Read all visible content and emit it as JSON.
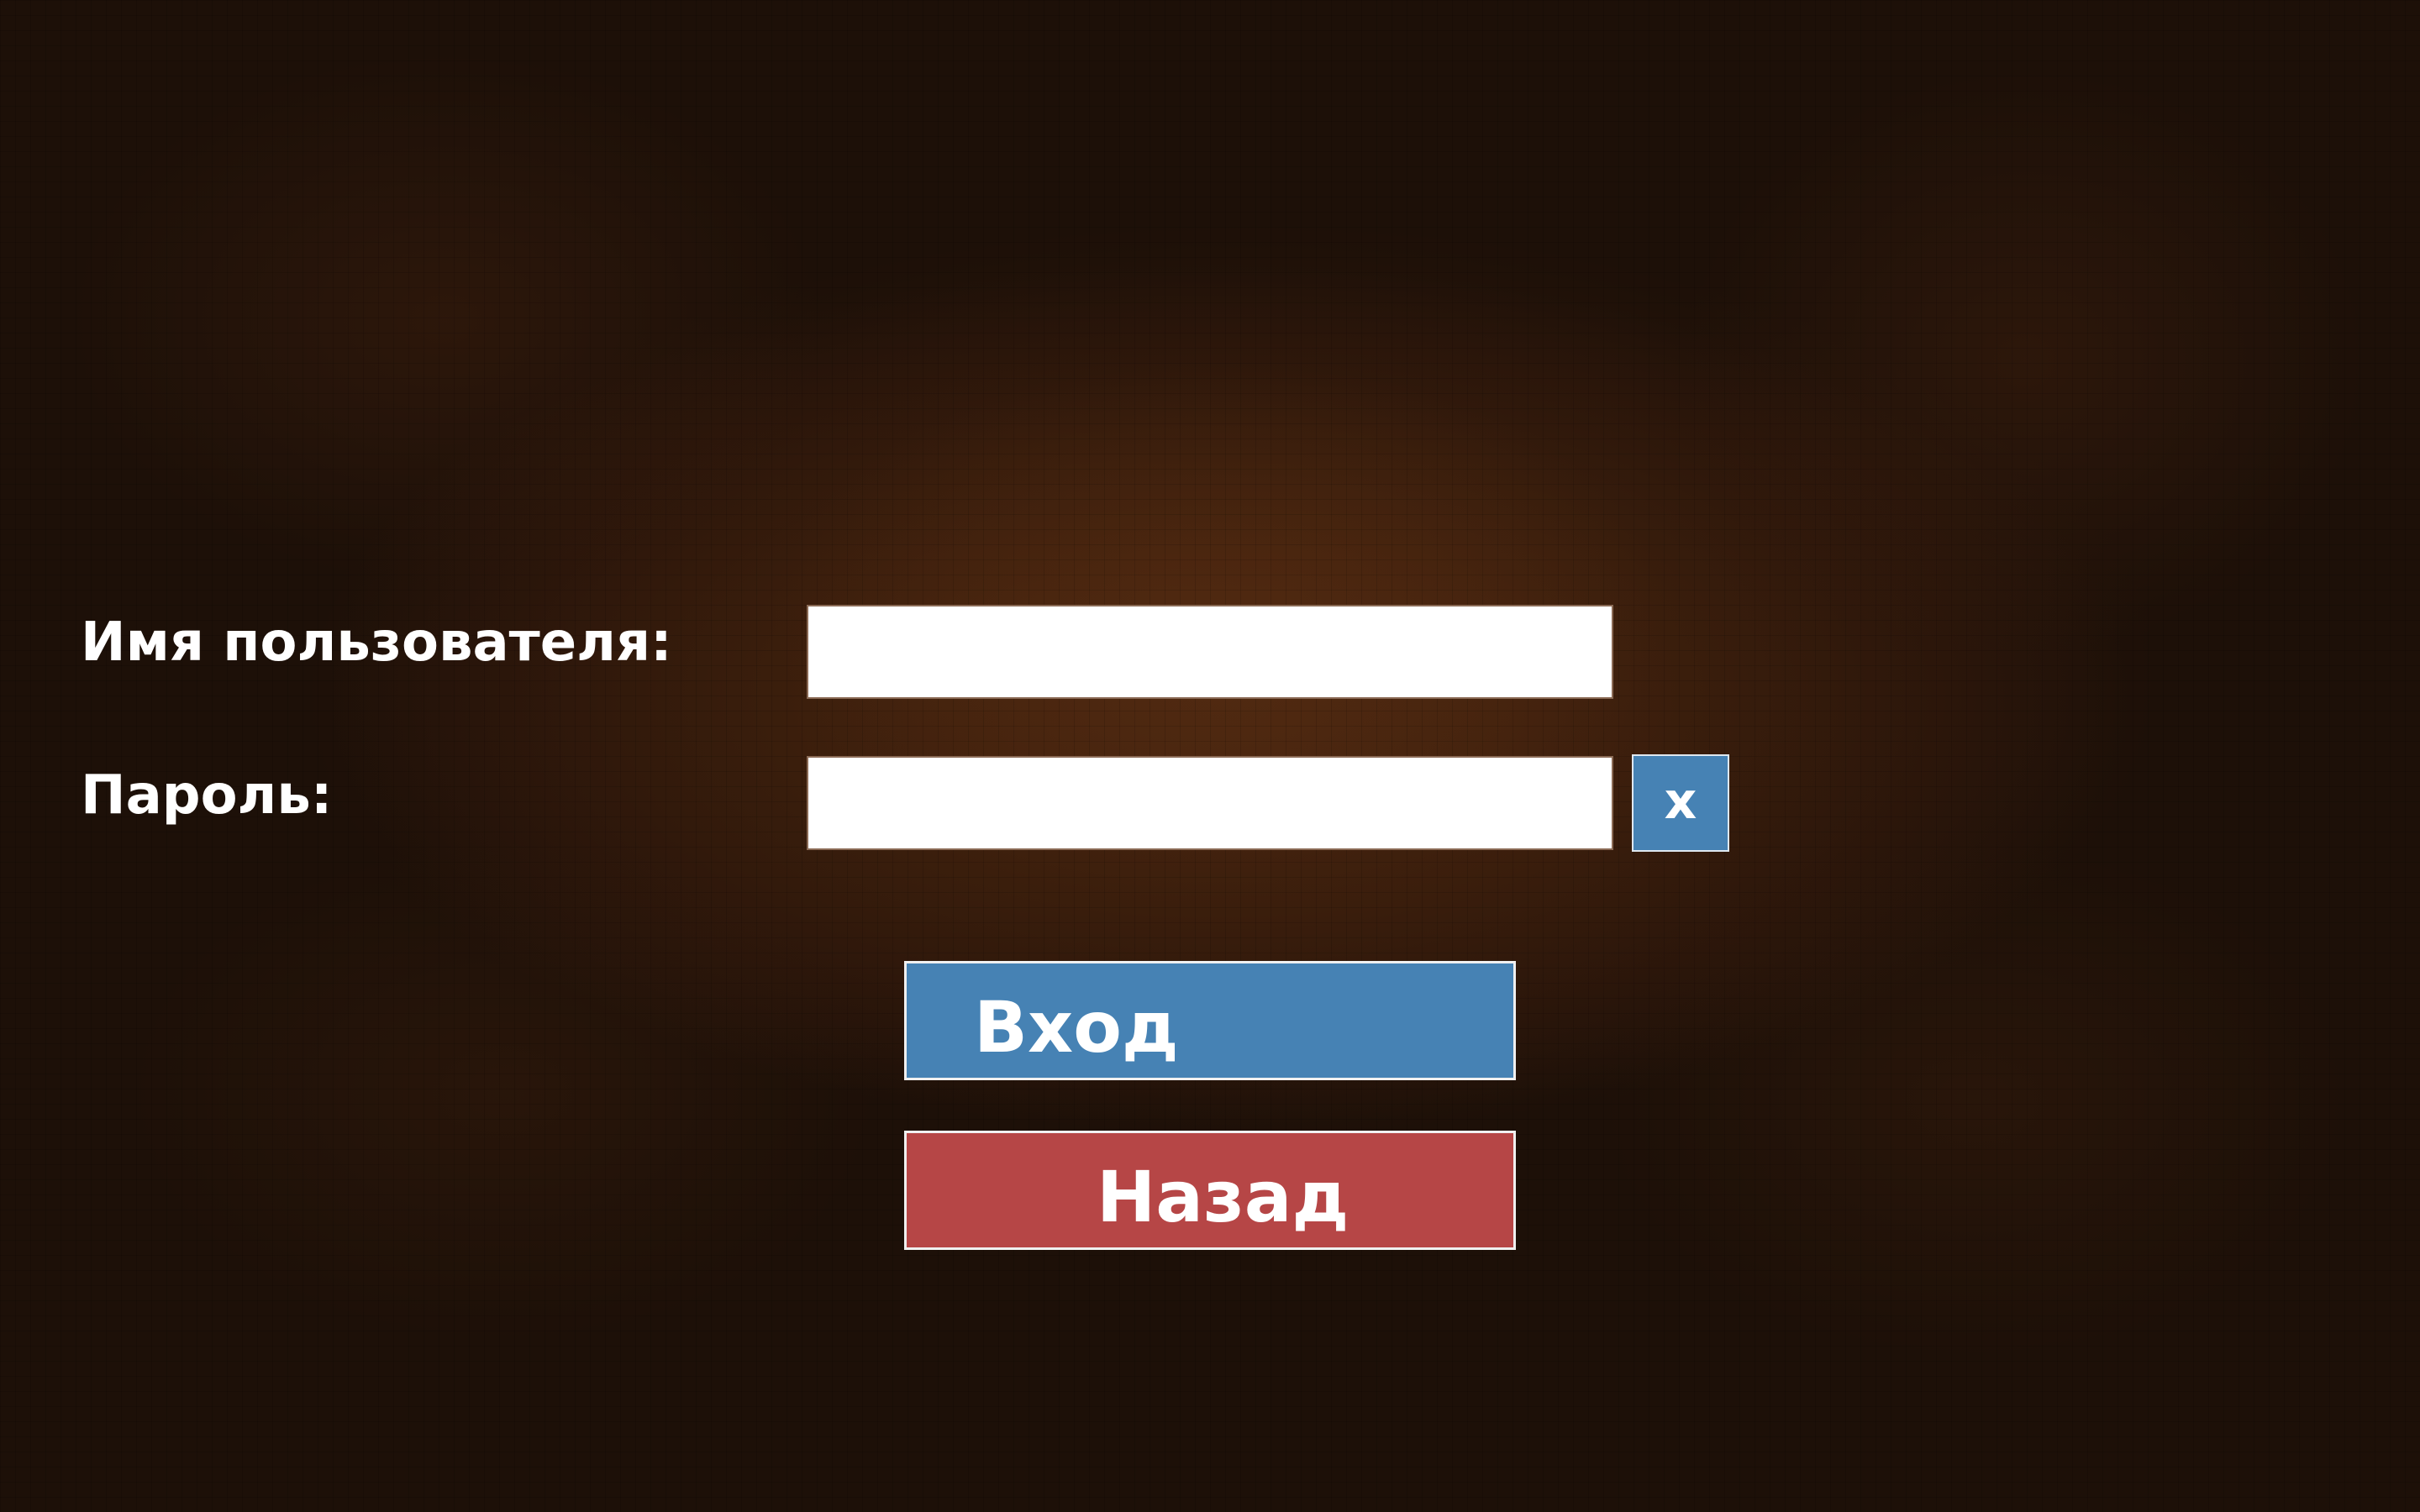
{
  "form": {
    "username_label": "Имя пользователя:",
    "username_value": "",
    "password_label": "Пароль:",
    "password_value": "",
    "clear_label": "x"
  },
  "buttons": {
    "login_label": "Вход",
    "back_label": "Назад"
  },
  "colors": {
    "background": "#1c0f07",
    "background_glow": "#4a2711",
    "login_button": "#4682b4",
    "back_button": "#b64646",
    "clear_button": "#4682b4",
    "input_background": "#ffffff",
    "label_text": "#ffffff"
  },
  "icons": {
    "clear": "close-icon"
  }
}
